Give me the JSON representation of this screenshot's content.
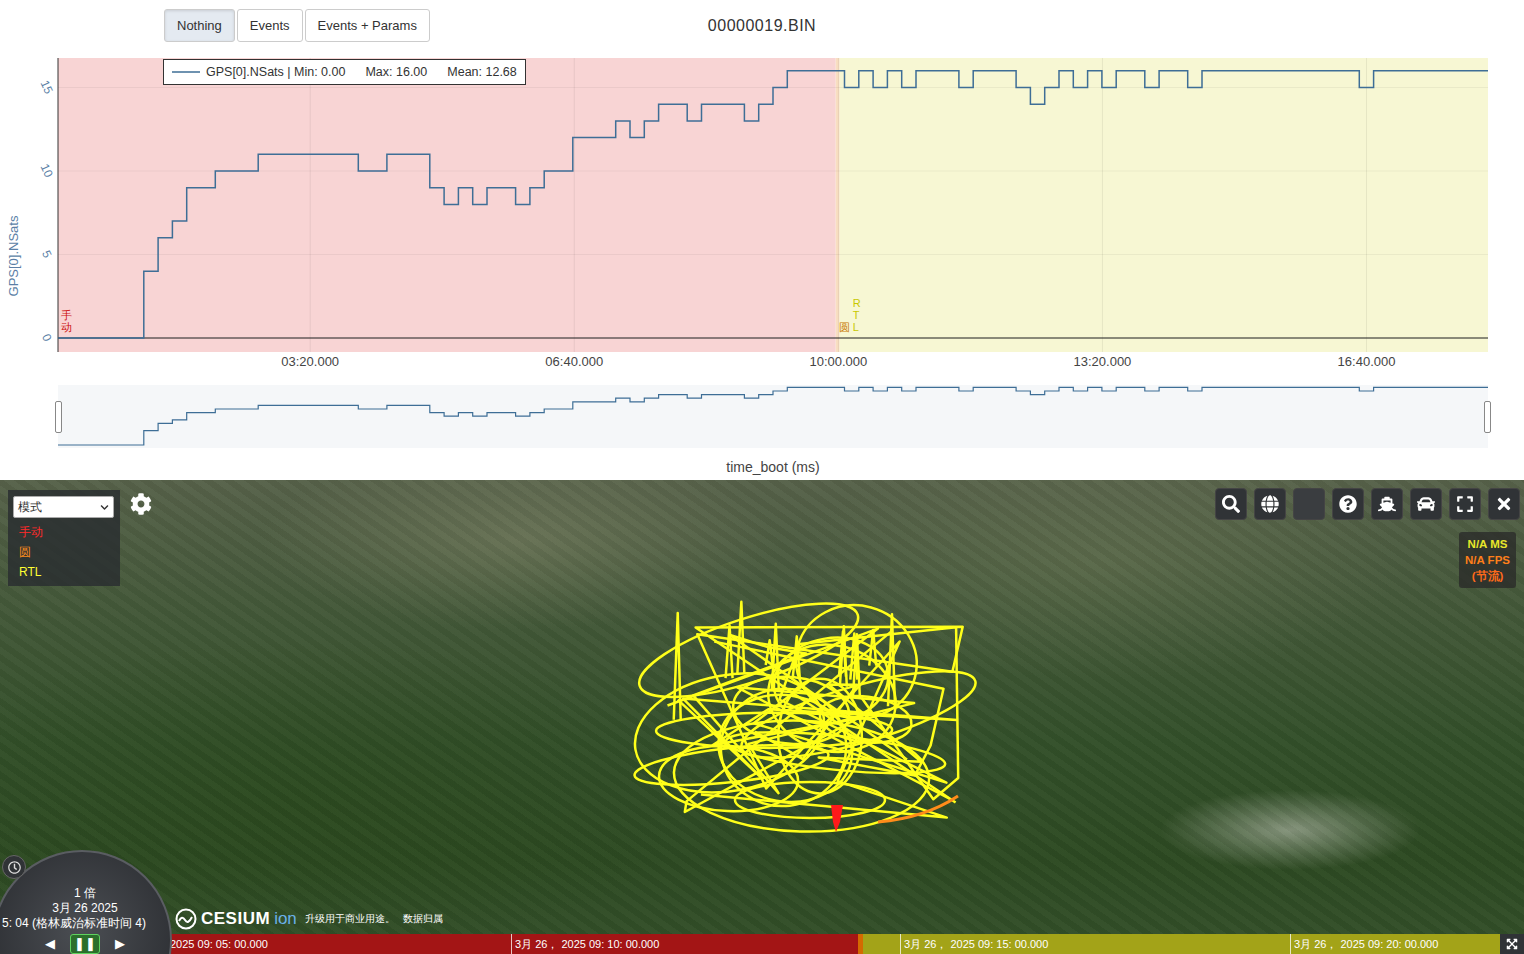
{
  "file_title": "00000019.BIN",
  "view_buttons": [
    {
      "label": "Nothing",
      "selected": true
    },
    {
      "label": "Events",
      "selected": false
    },
    {
      "label": "Events + Params",
      "selected": false
    }
  ],
  "chart": {
    "y_title": "GPS[0].NSats",
    "y_ticks": [
      {
        "label": "0",
        "value": 0
      },
      {
        "label": "5",
        "value": 5
      },
      {
        "label": "10",
        "value": 10
      },
      {
        "label": "15",
        "value": 15
      }
    ],
    "x_ticks": [
      {
        "label": "03:20.000",
        "t": 200
      },
      {
        "label": "06:40.000",
        "t": 400
      },
      {
        "label": "10:00.000",
        "t": 600
      },
      {
        "label": "13:20.000",
        "t": 800
      },
      {
        "label": "16:40.000",
        "t": 1000
      }
    ],
    "x_range": [
      9,
      1092
    ],
    "x_title": "time_boot (ms)",
    "legend": [
      "GPS[0].NSats | Min: 0.00",
      "Max: 16.00",
      "Mean: 12.68"
    ],
    "modes": [
      {
        "label": "手动",
        "start": 9,
        "end": 598,
        "color": "#f8d4d4",
        "text_color": "#cc1111"
      },
      {
        "label": "圆",
        "start": 598,
        "end": 601,
        "color": "#f9dfc2",
        "text_color": "#c87800"
      },
      {
        "label": "RTL",
        "start": 601,
        "end": 1092,
        "color": "#f7f7d3",
        "text_color": "#c8c800"
      }
    ],
    "series": {
      "name": "GPS[0].NSats",
      "color": "#3e6e96",
      "values": [
        0,
        0,
        0,
        0,
        0,
        0,
        4,
        6,
        7,
        9,
        9,
        10,
        10,
        10,
        11,
        11,
        11,
        11,
        11,
        11,
        11,
        10,
        10,
        11,
        11,
        11,
        9,
        8,
        9,
        8,
        9,
        9,
        8,
        9,
        10,
        10,
        12,
        12,
        12,
        13,
        12,
        13,
        14,
        14,
        13,
        14,
        14,
        14,
        13,
        14,
        15,
        16,
        16,
        16,
        16,
        15,
        16,
        15,
        16,
        15,
        16,
        16,
        16,
        15,
        16,
        16,
        16,
        15,
        14,
        15,
        16,
        15,
        16,
        15,
        16,
        16,
        15,
        16,
        16,
        15,
        16,
        16,
        16,
        16,
        16,
        16,
        16,
        16,
        16,
        16,
        16,
        15,
        16,
        16,
        16,
        16,
        16,
        16,
        16,
        16
      ]
    }
  },
  "map": {
    "mode_select": {
      "placeholder": "模式"
    },
    "mode_legend": [
      {
        "label": "手动",
        "color": "#ff2a2a"
      },
      {
        "label": "圆",
        "color": "#ff8c1a"
      },
      {
        "label": "RTL",
        "color": "#ffff33"
      }
    ],
    "perf": [
      {
        "label": "N/A MS",
        "color": "#e8e82a"
      },
      {
        "label": "N/A FPS",
        "color": "#ff7f1a"
      },
      {
        "label": "(节流)",
        "color": "#ff6a1a"
      }
    ],
    "track": [
      {
        "kind": "loops",
        "color": "#ffff1a"
      },
      {
        "kind": "arc",
        "color": "#ff8c1a"
      },
      {
        "kind": "marker",
        "color": "#ff1a1a"
      }
    ],
    "clock": {
      "rate": "1 倍",
      "date": "3月 26 2025",
      "time": "5: 04 (格林威治标准时间 4)",
      "controls": [
        {
          "label": "◀",
          "selected": false
        },
        {
          "label": "❚❚",
          "selected": true
        },
        {
          "label": "▶",
          "selected": false
        }
      ]
    },
    "logo": {
      "name": "CESIUM",
      "suffix": "ion"
    },
    "credits": [
      "升级用于商业用途。",
      "数据归属"
    ],
    "timeline": {
      "segments": [
        {
          "share": 0.518,
          "color": "#a31515"
        },
        {
          "share": 0.004,
          "color": "#d46a00"
        },
        {
          "share": 0.478,
          "color": "#a3a318"
        }
      ],
      "labels": [
        "2025 09: 05: 00.000",
        "3月 26， 2025 09: 10: 00.000",
        "3月 26， 2025 09: 15: 00.000",
        "3月 26， 2025 09: 20: 00.000"
      ]
    }
  }
}
